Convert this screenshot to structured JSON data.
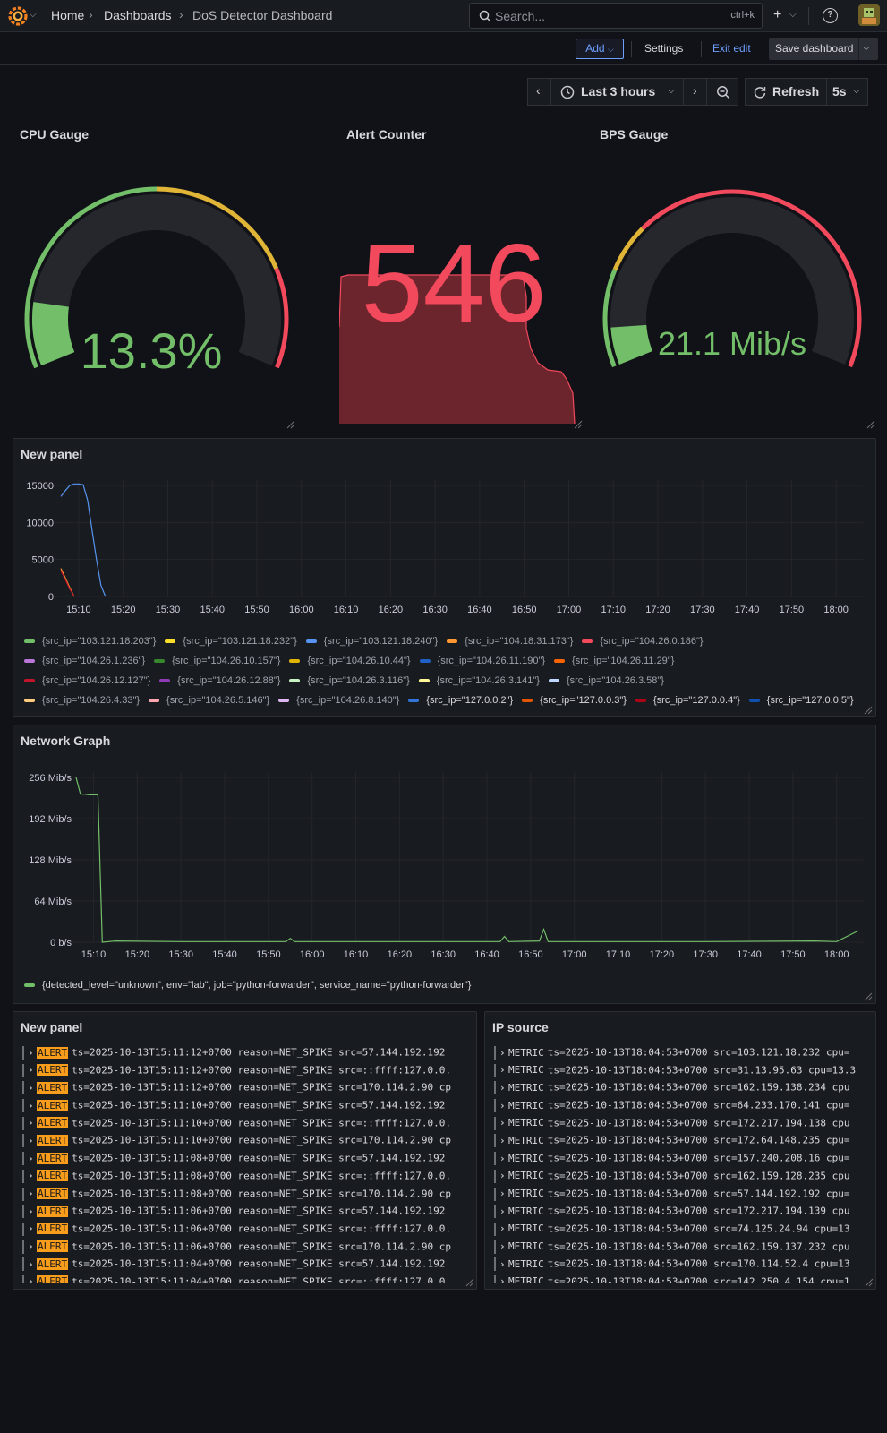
{
  "topbar": {
    "breadcrumb": [
      "Home",
      "Dashboards",
      "DoS Detector Dashboard"
    ],
    "search_placeholder": "Search...",
    "search_shortcut": "ctrl+k",
    "plus_label": "+",
    "help_label": "?"
  },
  "toolbar": {
    "add_label": "Add",
    "settings_label": "Settings",
    "exit_edit_label": "Exit edit",
    "save_label": "Save dashboard"
  },
  "time_picker": {
    "range_label": "Last 3 hours",
    "refresh_label": "Refresh",
    "refresh_interval": "5s"
  },
  "colors": {
    "green": "#73bf69",
    "yellow": "#f2cc0c",
    "orange": "#ff9830",
    "red": "#f2495c",
    "blue": "#5794f2",
    "alert_bg": "#f89c1c"
  },
  "panels": {
    "cpu_gauge": {
      "title": "CPU Gauge",
      "value_text": "13.3%",
      "value_fraction": 0.133,
      "thresholds": [
        {
          "until": 0.5,
          "color": "#73bf69"
        },
        {
          "until": 0.8,
          "color": "#e0b437"
        },
        {
          "until": 1.0,
          "color": "#f2495c"
        }
      ]
    },
    "alert_counter": {
      "title": "Alert Counter",
      "value": "546",
      "color": "#f2495c"
    },
    "bps_gauge": {
      "title": "BPS Gauge",
      "value_text": "21.1 Mib/s",
      "value_fraction": 0.08,
      "thresholds": [
        {
          "until": 0.2,
          "color": "#73bf69"
        },
        {
          "until": 0.3,
          "color": "#e0b437"
        },
        {
          "until": 1.0,
          "color": "#f2495c"
        }
      ]
    },
    "new_panel_chart": {
      "title": "New panel",
      "legend": [
        {
          "label": "{src_ip=\"103.121.18.203\"}",
          "color": "#73bf69"
        },
        {
          "label": "{src_ip=\"103.121.18.232\"}",
          "color": "#fade2a"
        },
        {
          "label": "{src_ip=\"103.121.18.240\"}",
          "color": "#5794f2"
        },
        {
          "label": "{src_ip=\"104.18.31.173\"}",
          "color": "#ff9830"
        },
        {
          "label": "{src_ip=\"104.26.0.186\"}",
          "color": "#f2495c"
        },
        {
          "label": "{src_ip=\"104.26.1.236\"}",
          "color": "#b877d9"
        },
        {
          "label": "{src_ip=\"104.26.10.157\"}",
          "color": "#37872d"
        },
        {
          "label": "{src_ip=\"104.26.10.44\"}",
          "color": "#e0b400"
        },
        {
          "label": "{src_ip=\"104.26.11.190\"}",
          "color": "#1f60c4"
        },
        {
          "label": "{src_ip=\"104.26.11.29\"}",
          "color": "#fa6400"
        },
        {
          "label": "{src_ip=\"104.26.12.127\"}",
          "color": "#c4162a"
        },
        {
          "label": "{src_ip=\"104.26.12.88\"}",
          "color": "#8f3bb8"
        },
        {
          "label": "{src_ip=\"104.26.3.116\"}",
          "color": "#c8f2c2"
        },
        {
          "label": "{src_ip=\"104.26.3.141\"}",
          "color": "#fff899"
        },
        {
          "label": "{src_ip=\"104.26.3.58\"}",
          "color": "#c0d8ff"
        },
        {
          "label": "{src_ip=\"104.26.4.33\"}",
          "color": "#ffcb7d"
        },
        {
          "label": "{src_ip=\"104.26.5.146\"}",
          "color": "#ffa6b0"
        },
        {
          "label": "{src_ip=\"104.26.8.140\"}",
          "color": "#deb6f2"
        },
        {
          "label": "{src_ip=\"127.0.0.2\"}",
          "color": "#3274d9"
        },
        {
          "label": "{src_ip=\"127.0.0.3\"}",
          "color": "#e55400"
        },
        {
          "label": "{src_ip=\"127.0.0.4\"}",
          "color": "#ad0317"
        },
        {
          "label": "{src_ip=\"127.0.0.5\"}",
          "color": "#1250b0"
        }
      ]
    },
    "network_graph": {
      "title": "Network Graph",
      "legend": [
        {
          "label": "{detected_level=\"unknown\", env=\"lab\", job=\"python-forwarder\", service_name=\"python-forwarder\"}",
          "color": "#73bf69"
        }
      ]
    },
    "new_panel_logs": {
      "title": "New panel",
      "badge": "ALERT",
      "lines": [
        "ts=2025-10-13T15:11:12+0700 reason=NET_SPIKE src=57.144.192.192",
        "ts=2025-10-13T15:11:12+0700 reason=NET_SPIKE src=::ffff:127.0.0.",
        "ts=2025-10-13T15:11:12+0700 reason=NET_SPIKE src=170.114.2.90 cp",
        "ts=2025-10-13T15:11:10+0700 reason=NET_SPIKE src=57.144.192.192",
        "ts=2025-10-13T15:11:10+0700 reason=NET_SPIKE src=::ffff:127.0.0.",
        "ts=2025-10-13T15:11:10+0700 reason=NET_SPIKE src=170.114.2.90 cp",
        "ts=2025-10-13T15:11:08+0700 reason=NET_SPIKE src=57.144.192.192",
        "ts=2025-10-13T15:11:08+0700 reason=NET_SPIKE src=::ffff:127.0.0.",
        "ts=2025-10-13T15:11:08+0700 reason=NET_SPIKE src=170.114.2.90 cp",
        "ts=2025-10-13T15:11:06+0700 reason=NET_SPIKE src=57.144.192.192",
        "ts=2025-10-13T15:11:06+0700 reason=NET_SPIKE src=::ffff:127.0.0.",
        "ts=2025-10-13T15:11:06+0700 reason=NET_SPIKE src=170.114.2.90 cp",
        "ts=2025-10-13T15:11:04+0700 reason=NET_SPIKE src=57.144.192.192",
        "ts=2025-10-13T15:11:04+0700 reason=NET_SPIKE src=::ffff:127.0.0."
      ]
    },
    "ip_source": {
      "title": "IP source",
      "badge": "METRIC",
      "lines": [
        "ts=2025-10-13T18:04:53+0700 src=103.121.18.232 cpu=",
        "ts=2025-10-13T18:04:53+0700 src=31.13.95.63 cpu=13.3",
        "ts=2025-10-13T18:04:53+0700 src=162.159.138.234 cpu",
        "ts=2025-10-13T18:04:53+0700 src=64.233.170.141 cpu=",
        "ts=2025-10-13T18:04:53+0700 src=172.217.194.138 cpu",
        "ts=2025-10-13T18:04:53+0700 src=172.64.148.235 cpu=",
        "ts=2025-10-13T18:04:53+0700 src=157.240.208.16 cpu=",
        "ts=2025-10-13T18:04:53+0700 src=162.159.128.235 cpu",
        "ts=2025-10-13T18:04:53+0700 src=57.144.192.192 cpu=",
        "ts=2025-10-13T18:04:53+0700 src=172.217.194.139 cpu",
        "ts=2025-10-13T18:04:53+0700 src=74.125.24.94 cpu=13",
        "ts=2025-10-13T18:04:53+0700 src=162.159.137.232 cpu",
        "ts=2025-10-13T18:04:53+0700 src=170.114.52.4 cpu=13",
        "ts=2025-10-13T18:04:53+0700 src=142.250.4.154 cpu=1"
      ]
    }
  },
  "chart_data": [
    {
      "type": "line",
      "panel": "New panel",
      "xlabels": [
        "15:10",
        "15:20",
        "15:30",
        "15:40",
        "15:50",
        "16:00",
        "16:10",
        "16:20",
        "16:30",
        "16:40",
        "16:50",
        "17:00",
        "17:10",
        "17:20",
        "17:30",
        "17:40",
        "17:50",
        "18:00"
      ],
      "yticks": [
        "15000",
        "10000",
        "5000",
        "0"
      ],
      "ylim": [
        0,
        15000
      ],
      "series": [
        {
          "name": "{src_ip=\"103.121.18.240\"}",
          "color": "#5794f2",
          "x": [
            "15:06",
            "15:07",
            "15:08",
            "15:09",
            "15:10",
            "15:11",
            "15:12",
            "15:13",
            "15:14",
            "15:15",
            "15:16"
          ],
          "y": [
            13500,
            14300,
            15000,
            15200,
            15200,
            15100,
            13000,
            9000,
            5000,
            1500,
            0
          ]
        },
        {
          "name": "{src_ip=\"104.18.31.173\"}",
          "color": "#ff9830",
          "x": [
            "15:06",
            "15:07",
            "15:08",
            "15:09"
          ],
          "y": [
            3800,
            2500,
            1200,
            0
          ]
        },
        {
          "name": "{src_ip=\"104.26.12.127\"}",
          "color": "#c4162a",
          "x": [
            "15:06",
            "15:07",
            "15:08",
            "15:09"
          ],
          "y": [
            3500,
            2300,
            1000,
            0
          ]
        }
      ]
    },
    {
      "type": "line",
      "panel": "Network Graph",
      "xlabels": [
        "15:10",
        "15:20",
        "15:30",
        "15:40",
        "15:50",
        "16:00",
        "16:10",
        "16:20",
        "16:30",
        "16:40",
        "16:50",
        "17:00",
        "17:10",
        "17:20",
        "17:30",
        "17:40",
        "17:50",
        "18:00"
      ],
      "yticks": [
        "256 Mib/s",
        "192 Mib/s",
        "128 Mib/s",
        "64 Mib/s",
        "0 b/s"
      ],
      "ylim": [
        0,
        256
      ],
      "series": [
        {
          "name": "{detected_level=\"unknown\", env=\"lab\", job=\"python-forwarder\", service_name=\"python-forwarder\"}",
          "color": "#73bf69",
          "x": [
            "15:06",
            "15:07",
            "15:08",
            "15:09",
            "15:10",
            "15:11",
            "15:12",
            "15:15",
            "15:30",
            "15:45",
            "15:54",
            "15:55",
            "15:56",
            "16:10",
            "16:30",
            "16:43",
            "16:44",
            "16:45",
            "16:52",
            "16:53",
            "16:54",
            "17:10",
            "17:30",
            "17:55",
            "18:00",
            "18:05"
          ],
          "y": [
            256,
            230,
            230,
            229,
            229,
            229,
            0,
            2,
            1,
            1,
            1,
            6,
            1,
            1,
            1,
            1,
            9,
            1,
            2,
            20,
            1,
            1,
            1,
            2,
            1,
            18
          ]
        }
      ]
    }
  ]
}
